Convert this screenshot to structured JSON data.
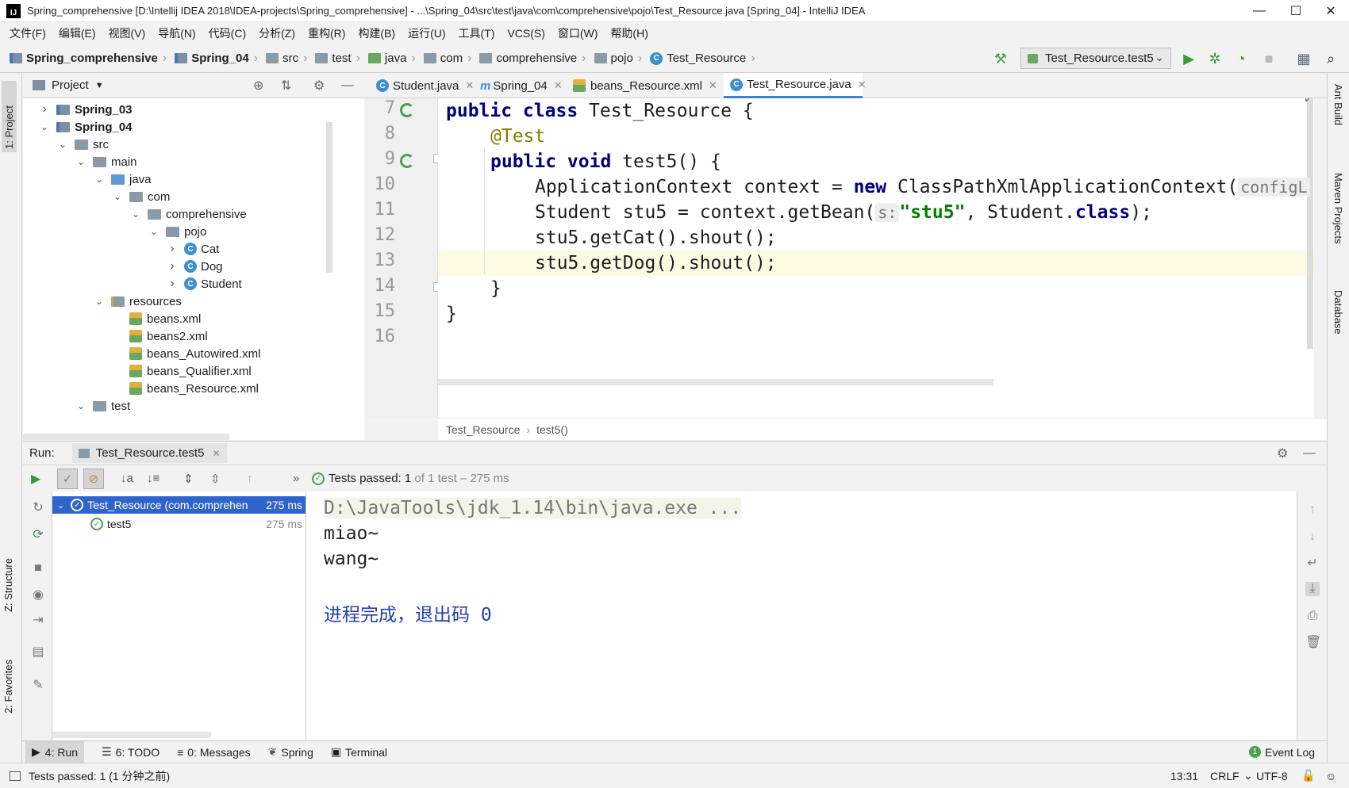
{
  "window": {
    "title": "Spring_comprehensive [D:\\Intellij IDEA 2018\\IDEA-projects\\Spring_comprehensive] - ...\\Spring_04\\src\\test\\java\\com\\comprehensive\\pojo\\Test_Resource.java [Spring_04] - IntelliJ IDEA",
    "app_icon": "IJ"
  },
  "menu": [
    "文件(F)",
    "编辑(E)",
    "视图(V)",
    "导航(N)",
    "代码(C)",
    "分析(Z)",
    "重构(R)",
    "构建(B)",
    "运行(U)",
    "工具(T)",
    "VCS(S)",
    "窗口(W)",
    "帮助(H)"
  ],
  "breadcrumbs": [
    "Spring_comprehensive",
    "Spring_04",
    "src",
    "test",
    "java",
    "com",
    "comprehensive",
    "pojo",
    "Test_Resource"
  ],
  "run_config": "Test_Resource.test5",
  "left_stripe": {
    "project": "1: Project",
    "structure": "Z: Structure",
    "favorites": "2: Favorites"
  },
  "right_stripe": [
    "Ant Build",
    "Maven Projects",
    "Database"
  ],
  "project_panel": {
    "title": "Project",
    "tree": [
      {
        "label": "Spring_03",
        "depth": 0,
        "expanded": false,
        "kind": "module",
        "bold": true
      },
      {
        "label": "Spring_04",
        "depth": 0,
        "expanded": true,
        "kind": "module",
        "bold": true
      },
      {
        "label": "src",
        "depth": 1,
        "expanded": true,
        "kind": "folder"
      },
      {
        "label": "main",
        "depth": 2,
        "expanded": true,
        "kind": "folder"
      },
      {
        "label": "java",
        "depth": 3,
        "expanded": true,
        "kind": "src"
      },
      {
        "label": "com",
        "depth": 4,
        "expanded": true,
        "kind": "folder"
      },
      {
        "label": "comprehensive",
        "depth": 5,
        "expanded": true,
        "kind": "folder"
      },
      {
        "label": "pojo",
        "depth": 6,
        "expanded": true,
        "kind": "folder"
      },
      {
        "label": "Cat",
        "depth": 7,
        "expanded": false,
        "kind": "class"
      },
      {
        "label": "Dog",
        "depth": 7,
        "expanded": false,
        "kind": "class"
      },
      {
        "label": "Student",
        "depth": 7,
        "expanded": false,
        "kind": "class"
      },
      {
        "label": "resources",
        "depth": 3,
        "expanded": true,
        "kind": "res"
      },
      {
        "label": "beans.xml",
        "depth": 4,
        "kind": "xml"
      },
      {
        "label": "beans2.xml",
        "depth": 4,
        "kind": "xml"
      },
      {
        "label": "beans_Autowired.xml",
        "depth": 4,
        "kind": "xml"
      },
      {
        "label": "beans_Qualifier.xml",
        "depth": 4,
        "kind": "xml"
      },
      {
        "label": "beans_Resource.xml",
        "depth": 4,
        "kind": "xml"
      },
      {
        "label": "test",
        "depth": 2,
        "expanded": true,
        "kind": "folder"
      }
    ]
  },
  "editor": {
    "tabs": [
      {
        "label": "Student.java",
        "icon": "class-icon"
      },
      {
        "label": "Spring_04",
        "icon": "maven-icon"
      },
      {
        "label": "beans_Resource.xml",
        "icon": "xml-icon"
      },
      {
        "label": "Test_Resource.java",
        "icon": "class-icon",
        "active": true
      }
    ],
    "line_numbers": [
      "7",
      "8",
      "9",
      "10",
      "11",
      "12",
      "13",
      "14",
      "15",
      "16"
    ],
    "code": {
      "l7_kw": "public class",
      "l7_rest": " Test_Resource {",
      "l8_ann": "@Test",
      "l9_kw": "public void",
      "l9_rest": " test5() {",
      "l10_a": "ApplicationContext context = ",
      "l10_kw": "new",
      "l10_b": " ClassPathXmlApplicationContext(",
      "l10_hint": "configL",
      "l11_a": "Student stu5 = context.getBean(",
      "l11_hint": "s:",
      "l11_str": "\"stu5\"",
      "l11_b": ", Student.",
      "l11_kw": "class",
      "l11_c": ");",
      "l12": "stu5.getCat().shout();",
      "l13": "stu5.getDog().shout();",
      "l14": "}",
      "l15": "}"
    },
    "footer_crumbs": [
      "Test_Resource",
      "test5()"
    ]
  },
  "run": {
    "label": "Run:",
    "tab": "Test_Resource.test5",
    "status_prefix": "Tests passed:",
    "status_count": "1",
    "status_suffix": "of 1 test – 275 ms",
    "tree": [
      {
        "label": "Test_Resource (com.comprehen",
        "time": "275 ms"
      },
      {
        "label": "test5",
        "time": "275 ms"
      }
    ],
    "console": [
      "D:\\JavaTools\\jdk_1.14\\bin\\java.exe ...",
      "miao~",
      "wang~",
      "",
      "进程完成，退出码 0"
    ]
  },
  "bottom_tabs": [
    "4: Run",
    "6: TODO",
    "0: Messages",
    "Spring",
    "Terminal"
  ],
  "event_log": "Event Log",
  "status": {
    "message": "Tests passed: 1 (1 分钟之前)",
    "position": "13:31",
    "line_sep": "CRLF",
    "encoding": "UTF-8"
  },
  "colors": {
    "keyword": "#000080",
    "annotation": "#808000",
    "string": "#008000",
    "success": "#4aa24a",
    "selection": "#2f65ca"
  }
}
